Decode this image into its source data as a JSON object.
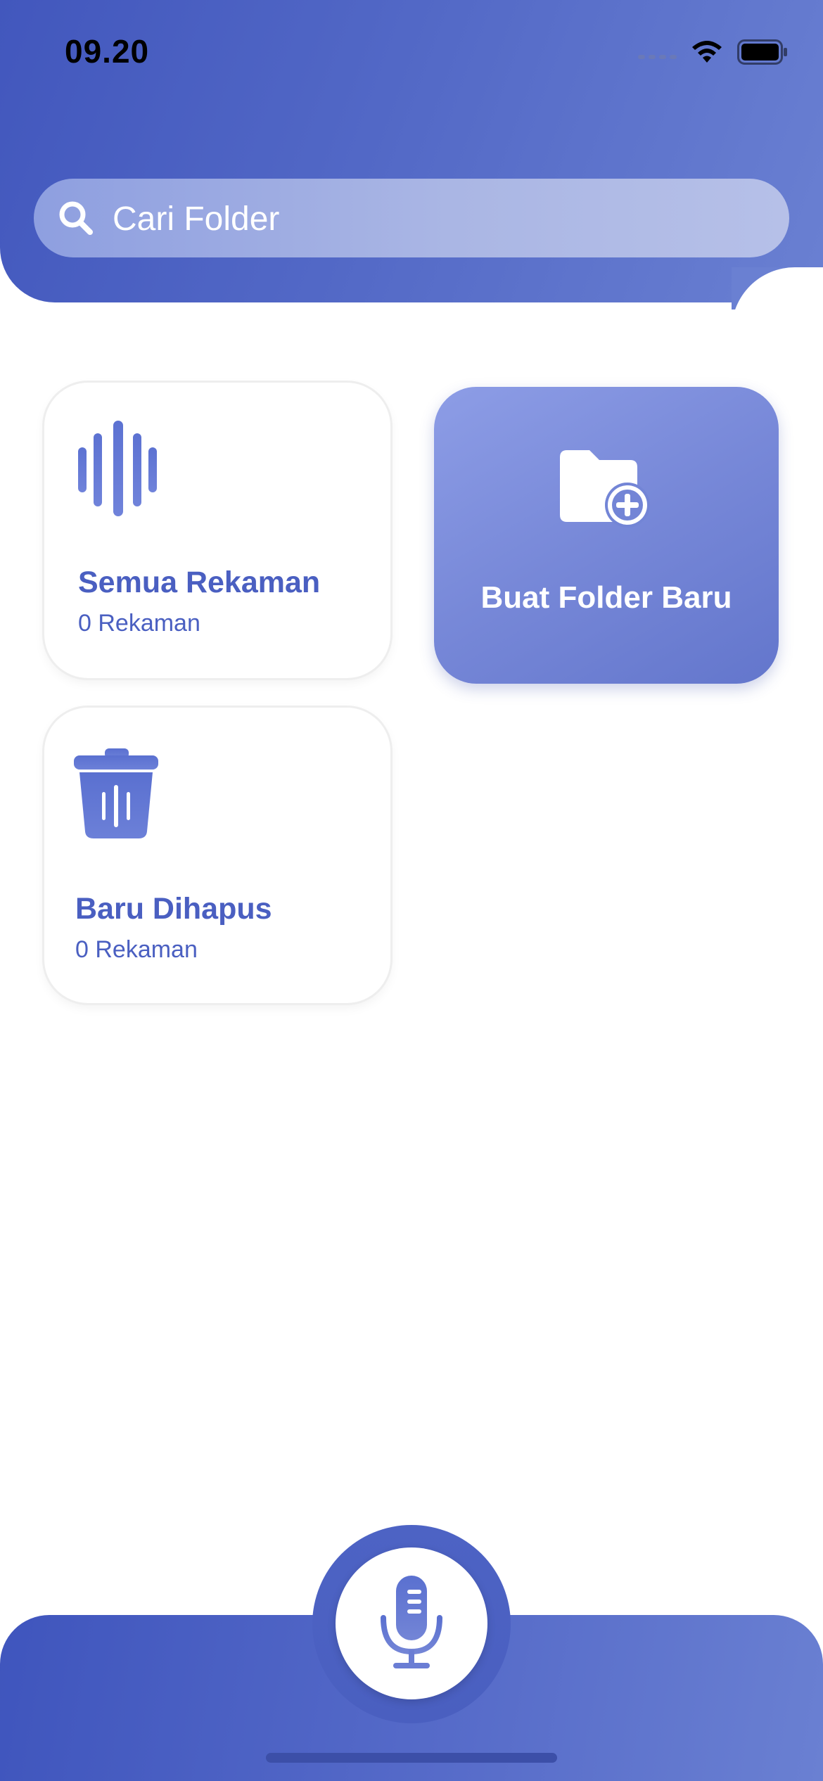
{
  "status_bar": {
    "time": "09.20",
    "icons": [
      "signal-icon",
      "wifi-icon",
      "battery-icon"
    ]
  },
  "search": {
    "placeholder": "Cari Folder",
    "icon": "search-icon"
  },
  "folders": [
    {
      "title": "Semua Rekaman",
      "count": "0 Rekaman",
      "icon": "waveform-icon"
    },
    {
      "title": "Baru Dihapus",
      "count": "0 Rekaman",
      "icon": "trash-icon"
    }
  ],
  "new_folder": {
    "label": "Buat Folder Baru",
    "icon": "folder-add-icon"
  },
  "record_button": {
    "icon": "microphone-icon"
  },
  "colors": {
    "primary": "#4a5fc1",
    "header_start": "#4257bd",
    "header_end": "#6a80d2",
    "card_new": "#7788d8"
  }
}
